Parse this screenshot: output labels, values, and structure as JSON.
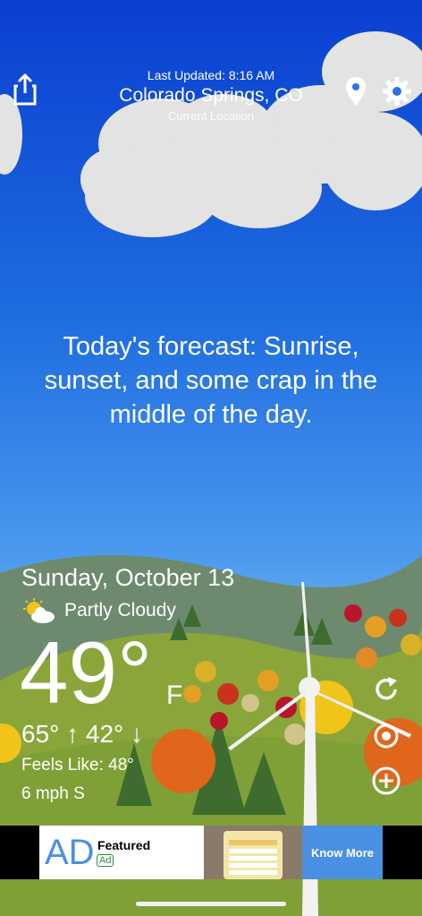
{
  "header": {
    "last_updated": "Last Updated: 8:16 AM",
    "city": "Colorado Springs, CO",
    "sub": "Current Location"
  },
  "icons": {
    "share": "share-icon",
    "location": "location-pin-icon",
    "settings": "gear-icon",
    "refresh": "refresh-icon",
    "camera": "camera-icon",
    "add": "plus-circle-icon",
    "partly_cloudy": "partly-cloudy-icon"
  },
  "forecast_text": "Today's forecast: Sunrise, sunset, and some crap in the middle of the day.",
  "weather": {
    "date": "Sunday, October 13",
    "condition": "Partly Cloudy",
    "temperature": "49°",
    "unit": "F",
    "high_low": "65° ↑  42° ↓",
    "feels_like": "Feels Like: 48°",
    "wind": "6 mph S"
  },
  "ad": {
    "logo": "AD",
    "title": "Featured",
    "tag": "Ad",
    "cta": "Know More"
  },
  "colors": {
    "sky_top": "#0a3fd0",
    "sky_bottom": "#6db1ef",
    "hill": "#7a9a3a",
    "accent_red": "#c8321e",
    "ad_button": "#4a90e2"
  }
}
